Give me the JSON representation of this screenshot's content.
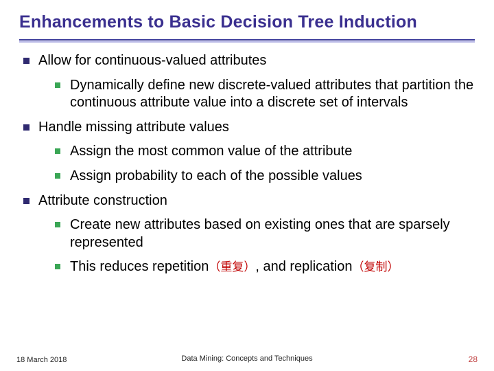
{
  "title": "Enhancements to Basic Decision Tree Induction",
  "bullets": {
    "b1": "Allow for continuous-valued attributes",
    "b1_1": "Dynamically define new discrete-valued attributes that partition the continuous attribute value into a discrete set of intervals",
    "b2": "Handle missing attribute values",
    "b2_1": "Assign the most common value of the attribute",
    "b2_2": "Assign probability to each of the possible values",
    "b3": "Attribute construction",
    "b3_1": "Create new attributes based on existing ones that are sparsely represented",
    "b3_2a": "This reduces repetition",
    "b3_2_cn1": "（重复）",
    "b3_2b": ", and replication",
    "b3_2_cn2": "（复制）"
  },
  "footer": {
    "date": "18 March 2018",
    "center": "Data Mining: Concepts and Techniques",
    "page": "28"
  }
}
